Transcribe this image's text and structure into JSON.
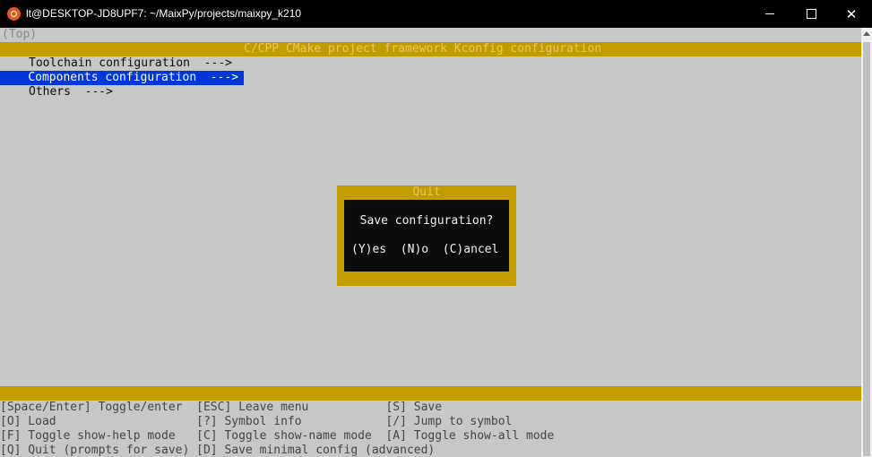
{
  "window": {
    "title": "lt@DESKTOP-JD8UPF7: ~/MaixPy/projects/maixpy_k210",
    "minimize_glyph": "",
    "close_glyph": "✕"
  },
  "breadcrumb": "(Top)",
  "header": "C/CPP CMake project framework Kconfig configuration",
  "menu": [
    {
      "label": "Toolchain configuration  --->"
    },
    {
      "label": "Components configuration  --->"
    },
    {
      "label": "Others  --->"
    }
  ],
  "dialog": {
    "title": "Quit",
    "question": "Save configuration?",
    "yes": "(Y)es",
    "no": "(N)o",
    "cancel": "(C)ancel"
  },
  "help_lines": [
    "[Space/Enter] Toggle/enter  [ESC] Leave menu           [S] Save",
    "[O] Load                    [?] Symbol info            [/] Jump to symbol",
    "[F] Toggle show-help mode   [C] Toggle show-name mode  [A] Toggle show-all mode",
    "[Q] Quit (prompts for save) [D] Save minimal config (advanced)"
  ],
  "colors": {
    "accent": "#c19c00",
    "selection": "#0037da",
    "background": "#c7c7c7",
    "dialog_bg": "#0c0c0c"
  }
}
